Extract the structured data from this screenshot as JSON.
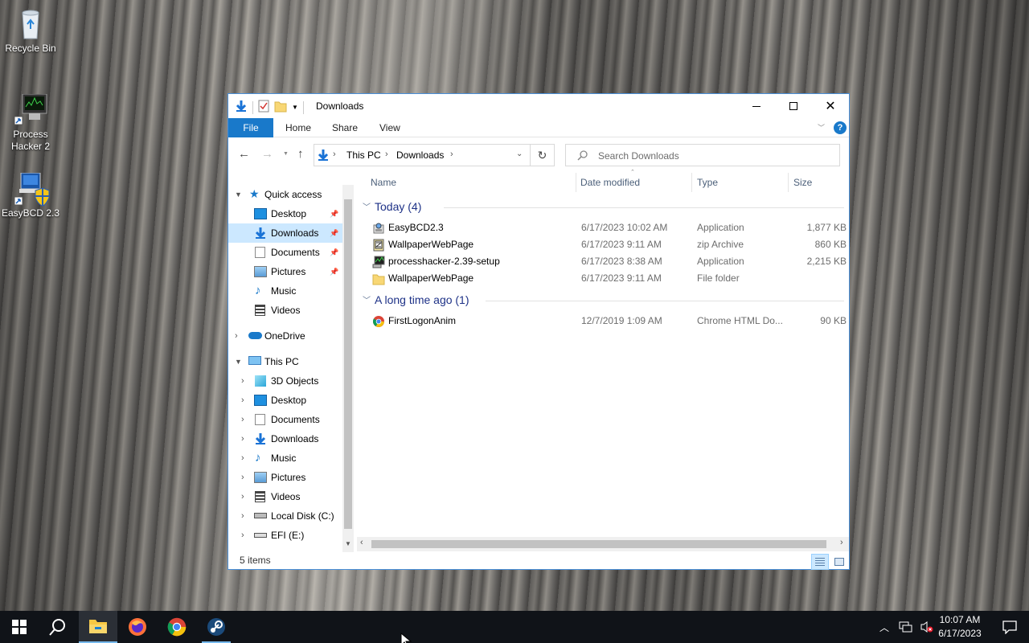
{
  "desktop": {
    "icons": [
      {
        "label": "Recycle Bin"
      },
      {
        "label": "Process Hacker 2"
      },
      {
        "label": "EasyBCD 2.3"
      }
    ]
  },
  "window": {
    "title": "Downloads",
    "ribbon": {
      "tabs": [
        "File",
        "Home",
        "Share",
        "View"
      ]
    },
    "address": {
      "crumbs": [
        "This PC",
        "Downloads"
      ]
    },
    "search": {
      "placeholder": "Search Downloads"
    },
    "nav": {
      "quick_access": "Quick access",
      "quick_items": [
        "Desktop",
        "Downloads",
        "Documents",
        "Pictures",
        "Music",
        "Videos"
      ],
      "onedrive": "OneDrive",
      "this_pc": "This PC",
      "pc_items": [
        "3D Objects",
        "Desktop",
        "Documents",
        "Downloads",
        "Music",
        "Pictures",
        "Videos",
        "Local Disk (C:)",
        "EFI (E:)"
      ]
    },
    "columns": [
      "Name",
      "Date modified",
      "Type",
      "Size"
    ],
    "groups": [
      {
        "title": "Today (4)",
        "files": [
          {
            "name": "EasyBCD2.3",
            "date": "6/17/2023 10:02 AM",
            "type": "Application",
            "size": "1,877 KB",
            "icon": "installer-icon"
          },
          {
            "name": "WallpaperWebPage",
            "date": "6/17/2023 9:11 AM",
            "type": "zip Archive",
            "size": "860 KB",
            "icon": "zip-icon"
          },
          {
            "name": "processhacker-2.39-setup",
            "date": "6/17/2023 8:38 AM",
            "type": "Application",
            "size": "2,215 KB",
            "icon": "setup-icon"
          },
          {
            "name": "WallpaperWebPage",
            "date": "6/17/2023 9:11 AM",
            "type": "File folder",
            "size": "",
            "icon": "folder-icon"
          }
        ]
      },
      {
        "title": "A long time ago (1)",
        "files": [
          {
            "name": "FirstLogonAnim",
            "date": "12/7/2019 1:09 AM",
            "type": "Chrome HTML Do...",
            "size": "90 KB",
            "icon": "chrome-icon"
          }
        ]
      }
    ],
    "status": "5 items"
  },
  "taskbar": {
    "time": "10:07 AM",
    "date": "6/17/2023"
  },
  "colors": {
    "accent": "#1979ca",
    "selection": "#cce8ff",
    "taskbar": "#101318"
  }
}
